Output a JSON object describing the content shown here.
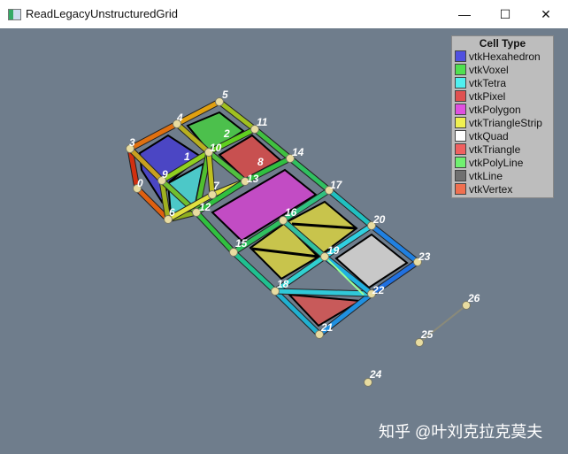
{
  "window": {
    "title": "ReadLegacyUnstructuredGrid",
    "minimize": "—",
    "maximize": "☐",
    "close": "✕"
  },
  "legend": {
    "title": "Cell Type",
    "items": [
      {
        "label": "vtkHexahedron",
        "color": "#5050e0"
      },
      {
        "label": "vtkVoxel",
        "color": "#50e050"
      },
      {
        "label": "vtkTetra",
        "color": "#50f0f0"
      },
      {
        "label": "vtkPixel",
        "color": "#e05050"
      },
      {
        "label": "vtkPolygon",
        "color": "#e050e0"
      },
      {
        "label": "vtkTriangleStrip",
        "color": "#f0f050"
      },
      {
        "label": "vtkQuad",
        "color": "#ffffff"
      },
      {
        "label": "vtkTriangle",
        "color": "#f06060"
      },
      {
        "label": "vtkPolyLine",
        "color": "#70f070"
      },
      {
        "label": "vtkLine",
        "color": "#707070"
      },
      {
        "label": "vtkVertex",
        "color": "#f07050"
      }
    ]
  },
  "point_labels": [
    "0",
    "1",
    "2",
    "3",
    "4",
    "5",
    "6",
    "7",
    "8",
    "9",
    "10",
    "11",
    "12",
    "13",
    "14",
    "15",
    "16",
    "17",
    "18",
    "19",
    "20",
    "21",
    "22",
    "23",
    "24",
    "25",
    "26"
  ],
  "watermark": "知乎 @叶刘克拉克莫夫"
}
